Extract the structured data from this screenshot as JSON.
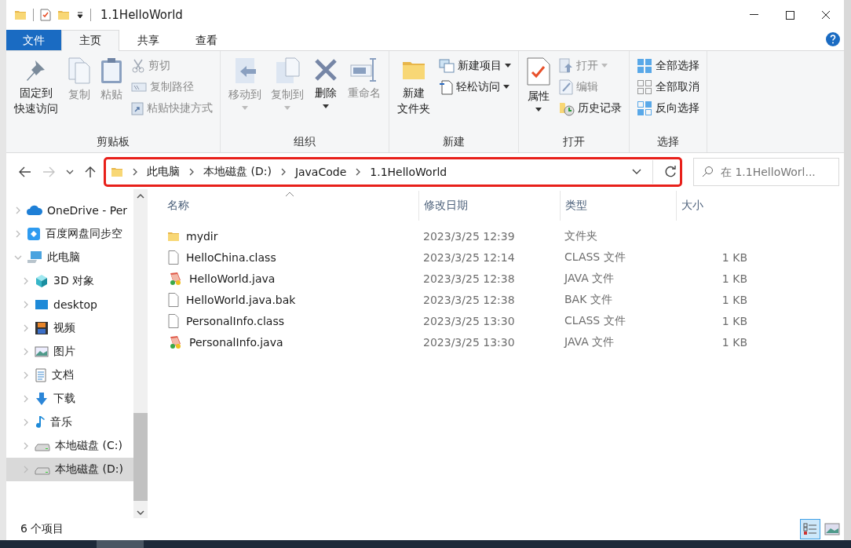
{
  "window": {
    "title": "1.1HelloWorld"
  },
  "ribbon_tabs": [
    {
      "label": "文件",
      "kind": "file",
      "selected": false
    },
    {
      "label": "主页",
      "kind": "tab",
      "selected": true
    },
    {
      "label": "共享",
      "kind": "tab",
      "selected": false
    },
    {
      "label": "查看",
      "kind": "tab",
      "selected": false
    }
  ],
  "ribbon_groups": [
    {
      "label": "剪贴板",
      "buttons": [
        {
          "lines": [
            "固定到",
            "快速访问"
          ],
          "kind": "large",
          "disabled": false,
          "dropdown": false
        },
        {
          "label": "复制",
          "kind": "large",
          "disabled": true,
          "dropdown": false
        },
        {
          "label": "粘贴",
          "kind": "large",
          "disabled": true,
          "dropdown": false
        },
        {
          "label": "剪切",
          "kind": "small",
          "disabled": true,
          "dropdown": false
        },
        {
          "label": "复制路径",
          "kind": "small",
          "disabled": true,
          "dropdown": false
        },
        {
          "label": "粘贴快捷方式",
          "kind": "small",
          "disabled": true,
          "dropdown": false
        }
      ]
    },
    {
      "label": "组织",
      "buttons": [
        {
          "label": "移动到",
          "kind": "large",
          "disabled": true,
          "dropdown": true
        },
        {
          "label": "复制到",
          "kind": "large",
          "disabled": true,
          "dropdown": true
        },
        {
          "label": "删除",
          "kind": "large",
          "disabled": false,
          "dropdown": true
        },
        {
          "label": "重命名",
          "kind": "large",
          "disabled": true,
          "dropdown": false
        }
      ]
    },
    {
      "label": "新建",
      "buttons": [
        {
          "lines": [
            "新建",
            "文件夹"
          ],
          "kind": "large",
          "disabled": false,
          "dropdown": false
        },
        {
          "label": "新建项目",
          "kind": "small",
          "disabled": false,
          "dropdown": true
        },
        {
          "label": "轻松访问",
          "kind": "small",
          "disabled": false,
          "dropdown": true
        }
      ]
    },
    {
      "label": "打开",
      "buttons": [
        {
          "label": "属性",
          "kind": "large",
          "disabled": false,
          "dropdown": true
        },
        {
          "label": "打开",
          "kind": "small",
          "disabled": true,
          "dropdown": true
        },
        {
          "label": "编辑",
          "kind": "small",
          "disabled": true,
          "dropdown": false
        },
        {
          "label": "历史记录",
          "kind": "small",
          "disabled": false,
          "dropdown": false
        }
      ]
    },
    {
      "label": "选择",
      "buttons": [
        {
          "label": "全部选择",
          "kind": "small",
          "disabled": false,
          "dropdown": false
        },
        {
          "label": "全部取消",
          "kind": "small",
          "disabled": false,
          "dropdown": false
        },
        {
          "label": "反向选择",
          "kind": "small",
          "disabled": false,
          "dropdown": false
        }
      ]
    }
  ],
  "address_bar": {
    "annotated": true,
    "crumbs": [
      "此电脑",
      "本地磁盘 (D:)",
      "JavaCode",
      "1.1HelloWorld"
    ]
  },
  "search": {
    "placeholder": "在 1.1HelloWorl..."
  },
  "nav_tree": [
    {
      "label": "OneDrive - Per",
      "kind": "cloud",
      "selected": false,
      "expanded": false
    },
    {
      "label": "百度网盘同步空",
      "kind": "sync",
      "selected": false,
      "expanded": false
    },
    {
      "label": "此电脑",
      "kind": "pc",
      "selected": false,
      "expanded": true,
      "children": [
        {
          "label": "3D 对象",
          "kind": "cube",
          "selected": false,
          "expanded": false
        },
        {
          "label": "desktop",
          "kind": "desktop",
          "selected": false,
          "expanded": false
        },
        {
          "label": "视频",
          "kind": "video",
          "selected": false,
          "expanded": false
        },
        {
          "label": "图片",
          "kind": "image",
          "selected": false,
          "expanded": false
        },
        {
          "label": "文档",
          "kind": "doc",
          "selected": false,
          "expanded": false
        },
        {
          "label": "下载",
          "kind": "download",
          "selected": false,
          "expanded": false
        },
        {
          "label": "音乐",
          "kind": "music",
          "selected": false,
          "expanded": false
        },
        {
          "label": "本地磁盘 (C:)",
          "kind": "drive",
          "selected": false,
          "expanded": false
        },
        {
          "label": "本地磁盘 (D:)",
          "kind": "drive",
          "selected": true,
          "expanded": false
        }
      ]
    }
  ],
  "table": {
    "columns": [
      "名称",
      "修改日期",
      "类型",
      "大小"
    ],
    "rows": [
      {
        "name": "mydir",
        "date": "2023/3/25 12:39",
        "type": "文件夹",
        "size": "",
        "kind": "folder"
      },
      {
        "name": "HelloChina.class",
        "date": "2023/3/25 12:14",
        "type": "CLASS 文件",
        "size": "1 KB",
        "kind": "file"
      },
      {
        "name": "HelloWorld.java",
        "date": "2023/3/25 12:38",
        "type": "JAVA 文件",
        "size": "1 KB",
        "kind": "java"
      },
      {
        "name": "HelloWorld.java.bak",
        "date": "2023/3/25 12:38",
        "type": "BAK 文件",
        "size": "1 KB",
        "kind": "file"
      },
      {
        "name": "PersonalInfo.class",
        "date": "2023/3/25 13:30",
        "type": "CLASS 文件",
        "size": "1 KB",
        "kind": "file"
      },
      {
        "name": "PersonalInfo.java",
        "date": "2023/3/25 13:30",
        "type": "JAVA 文件",
        "size": "1 KB",
        "kind": "java"
      }
    ]
  },
  "status_bar": {
    "count": "6 个项目",
    "views": [
      {
        "kind": "details",
        "selected": true
      },
      {
        "kind": "thumbnails",
        "selected": false
      }
    ]
  }
}
